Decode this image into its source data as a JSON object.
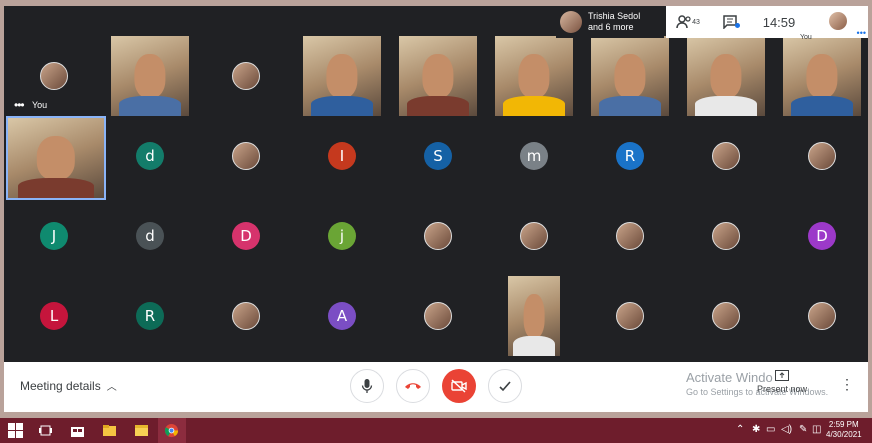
{
  "presenter": {
    "name": "Trishia Sedol",
    "more": "and 6 more"
  },
  "info": {
    "participant_count": "43",
    "time": "14:59",
    "you_label": "You"
  },
  "self_tile": {
    "label": "You"
  },
  "colors": {
    "accent": "#8ab4f8",
    "end_call": "#ea4335",
    "taskbar": "#6e1d2c"
  },
  "tiles": [
    {
      "col": 0,
      "row": 0,
      "type": "avatar"
    },
    {
      "col": 1,
      "row": 0,
      "type": "video"
    },
    {
      "col": 2,
      "row": 0,
      "type": "avatar"
    },
    {
      "col": 3,
      "row": 0,
      "type": "video"
    },
    {
      "col": 4,
      "row": 0,
      "type": "video"
    },
    {
      "col": 5,
      "row": 0,
      "type": "video"
    },
    {
      "col": 6,
      "row": 0,
      "type": "video"
    },
    {
      "col": 7,
      "row": 0,
      "type": "video"
    },
    {
      "col": 8,
      "row": 0,
      "type": "video"
    },
    {
      "col": 0,
      "row": 1,
      "type": "video"
    },
    {
      "col": 1,
      "row": 1,
      "type": "initial",
      "letter": "d",
      "color": "#137c6a"
    },
    {
      "col": 2,
      "row": 1,
      "type": "avatar"
    },
    {
      "col": 3,
      "row": 1,
      "type": "initial",
      "letter": "I",
      "color": "#c5391e"
    },
    {
      "col": 4,
      "row": 1,
      "type": "initial",
      "letter": "S",
      "color": "#1561a5"
    },
    {
      "col": 5,
      "row": 1,
      "type": "initial",
      "letter": "m",
      "color": "#7a8187"
    },
    {
      "col": 6,
      "row": 1,
      "type": "initial",
      "letter": "R",
      "color": "#1a73c8"
    },
    {
      "col": 7,
      "row": 1,
      "type": "avatar"
    },
    {
      "col": 8,
      "row": 1,
      "type": "avatar"
    },
    {
      "col": 0,
      "row": 2,
      "type": "initial",
      "letter": "J",
      "color": "#0f8a6f"
    },
    {
      "col": 1,
      "row": 2,
      "type": "initial",
      "letter": "d",
      "color": "#4a5256"
    },
    {
      "col": 2,
      "row": 2,
      "type": "initial",
      "letter": "D",
      "color": "#d6336c"
    },
    {
      "col": 3,
      "row": 2,
      "type": "initial",
      "letter": "j",
      "color": "#6aa535"
    },
    {
      "col": 4,
      "row": 2,
      "type": "avatar"
    },
    {
      "col": 5,
      "row": 2,
      "type": "avatar"
    },
    {
      "col": 6,
      "row": 2,
      "type": "avatar"
    },
    {
      "col": 7,
      "row": 2,
      "type": "avatar"
    },
    {
      "col": 8,
      "row": 2,
      "type": "initial",
      "letter": "D",
      "color": "#9c39c9"
    },
    {
      "col": 0,
      "row": 3,
      "type": "initial",
      "letter": "L",
      "color": "#c5153c"
    },
    {
      "col": 1,
      "row": 3,
      "type": "initial",
      "letter": "R",
      "color": "#0d6b57"
    },
    {
      "col": 2,
      "row": 3,
      "type": "avatar"
    },
    {
      "col": 3,
      "row": 3,
      "type": "initial",
      "letter": "A",
      "color": "#7b4ec4"
    },
    {
      "col": 4,
      "row": 3,
      "type": "avatar"
    },
    {
      "col": 5,
      "row": 3,
      "type": "video"
    },
    {
      "col": 6,
      "row": 3,
      "type": "avatar"
    },
    {
      "col": 7,
      "row": 3,
      "type": "avatar"
    },
    {
      "col": 8,
      "row": 3,
      "type": "avatar"
    }
  ],
  "bottom": {
    "meeting_details": "Meeting details",
    "activate_title": "Activate Windo",
    "activate_sub": "Go to Settings to activate Windows.",
    "present_now": "Present now"
  },
  "taskbar": {
    "time": "2:59 PM",
    "date": "4/30/2021"
  }
}
